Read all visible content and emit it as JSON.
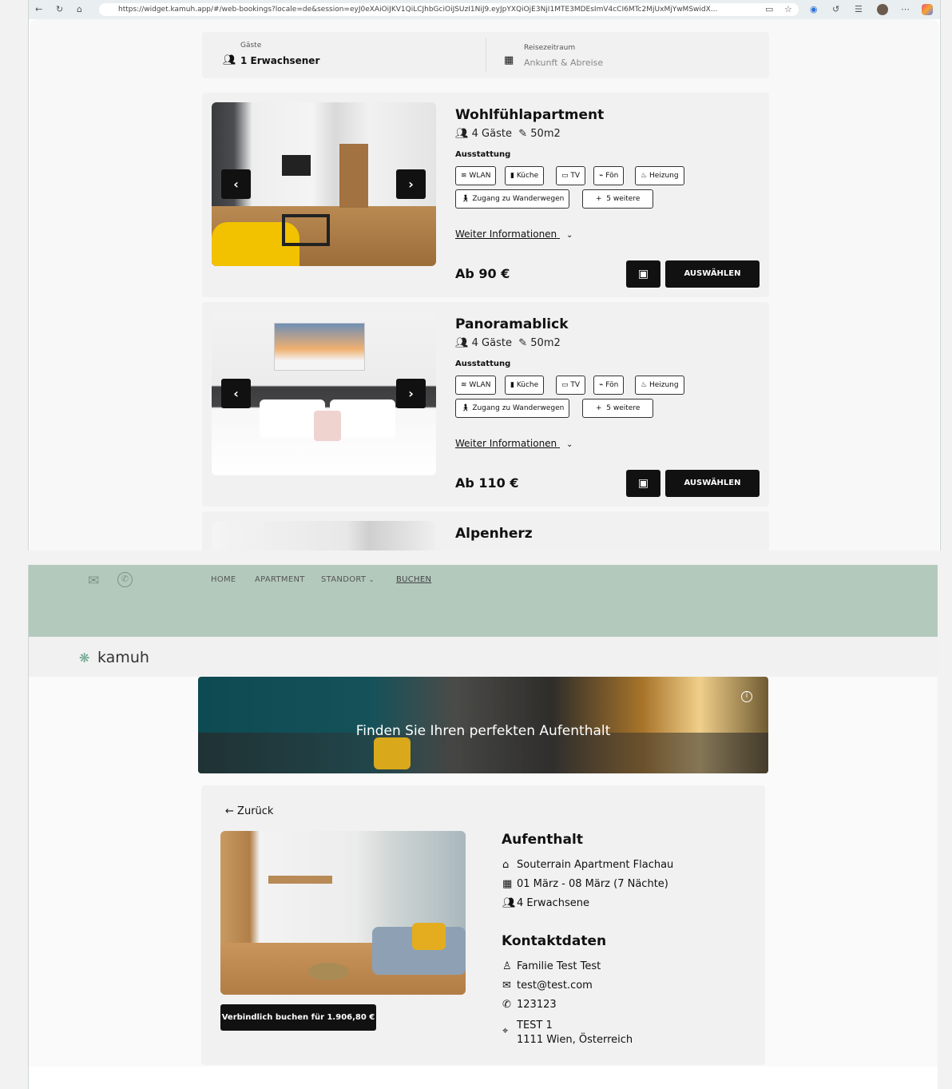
{
  "browser": {
    "url": "https://widget.kamuh.app/#/web-bookings?locale=de&session=eyJ0eXAiOiJKV1QiLCJhbGciOiJSUzI1NiJ9.eyJpYXQiOjE3NjI1MTE3MDEsImV4cCI6MTc2MjUxMjYwMSwidX...",
    "icons": [
      "back-icon",
      "reload-icon",
      "home-icon",
      "reader-icon",
      "star-icon",
      "shield-icon",
      "refresh-icon",
      "collections-icon",
      "avatar",
      "more-icon",
      "copilot-icon"
    ]
  },
  "search": {
    "guests_label": "Gäste",
    "guests_value": "1 Erwachsener",
    "period_label": "Reisezeitraum",
    "period_placeholder": "Ankunft & Abreise"
  },
  "listings": [
    {
      "title": "Wohlfühlapartment",
      "guests": "4 Gäste",
      "size": "50m2",
      "amenities_label": "Ausstattung",
      "amenities": [
        "WLAN",
        "Küche",
        "TV",
        "Fön",
        "Heizung",
        "Zugang zu Wanderwegen",
        "5 weitere"
      ],
      "more_info": "Weiter Informationen",
      "price": "Ab 90 €",
      "select": "AUSWÄHLEN"
    },
    {
      "title": "Panoramablick",
      "guests": "4 Gäste",
      "size": "50m2",
      "amenities_label": "Ausstattung",
      "amenities": [
        "WLAN",
        "Küche",
        "TV",
        "Fön",
        "Heizung",
        "Zugang zu Wanderwegen",
        "5 weitere"
      ],
      "more_info": "Weiter Informationen",
      "price": "Ab 110 €",
      "select": "AUSWÄHLEN"
    },
    {
      "title": "Alpenherz"
    }
  ],
  "nav": {
    "links": [
      "HOME",
      "APARTMENT",
      "STANDORT",
      "BUCHEN"
    ],
    "active": "BUCHEN",
    "logo": "kamuh"
  },
  "hero": {
    "headline": "Finden Sie Ihren perfekten Aufenthalt"
  },
  "booking": {
    "back": "Zurück",
    "stay_heading": "Aufenthalt",
    "apartment": "Souterrain Apartment Flachau",
    "dates": "01 März - 08 März (7 Nächte)",
    "guests": "4 Erwachsene",
    "contact_heading": "Kontaktdaten",
    "name": "Familie Test Test",
    "email": "test@test.com",
    "phone": "123123",
    "address_line1": "TEST 1",
    "address_line2": "1111 Wien, Österreich",
    "book_button": "Verbindlich buchen für 1.906,80 €"
  },
  "colors": {
    "nav_band": "#b3c9bc",
    "button": "#111111",
    "card": "#f1f1f1"
  }
}
